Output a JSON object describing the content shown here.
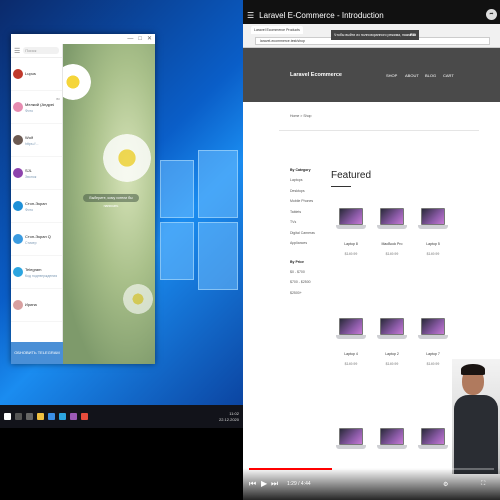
{
  "telegram": {
    "window_controls": [
      "—",
      "□",
      "✕"
    ],
    "search_placeholder": "Поиск",
    "chats": [
      {
        "name": "Lupus",
        "preview": "",
        "time": "",
        "color": "#c0392b"
      },
      {
        "name": "Мелкий (Андрей)",
        "preview": "Фото",
        "time": "вс",
        "color": "#e68bb0"
      },
      {
        "name": "Wolf",
        "preview": "https://...",
        "time": "",
        "color": "#6c5a52"
      },
      {
        "name": "SJL",
        "preview": "Звонок",
        "time": "",
        "color": "#8e44ad"
      },
      {
        "name": "Стоп-Экран",
        "preview": "Фото",
        "time": "",
        "color": "#1e90d8"
      },
      {
        "name": "Стоп-Экран Q",
        "preview": "Стикер",
        "time": "",
        "color": "#3b9be0"
      },
      {
        "name": "Telegram",
        "preview": "Код подтверждения",
        "time": "",
        "color": "#2ca5e0"
      },
      {
        "name": "Ирина",
        "preview": "",
        "time": "",
        "color": "#d8a0a0"
      }
    ],
    "bottom_label": "ОБНОВИТЬ TELEGRAM",
    "empty_hint": "Выберите, кому хотели бы написать"
  },
  "taskbar": {
    "clock_time": "11:02",
    "clock_date": "22.12.2020"
  },
  "youtube": {
    "title": "Laravel E-Commerce - Introduction",
    "share_icon": "share-icon",
    "time_display": "1:29 / 4:44",
    "progress_fraction": 0.34
  },
  "browser": {
    "tab_label": "Laravel Ecommerce Products",
    "url": "laravel-ecommerce.test/shop",
    "notice": "Чтобы выйти из полноэкранного режима, нажмите",
    "notice_key": "F11"
  },
  "site": {
    "brand": "Laravel Ecommerce",
    "nav": [
      "SHOP",
      "ABOUT",
      "BLOG",
      "CART"
    ],
    "breadcrumb": "Home > Shop",
    "category_heading": "By Category",
    "categories": [
      "Laptops",
      "Desktops",
      "Mobile Phones",
      "Tablets",
      "TVs",
      "Digital Cameras",
      "Appliances"
    ],
    "price_heading": "By Price",
    "prices": [
      "$0 - $700",
      "$700 - $2500",
      "$2500+"
    ],
    "featured_title": "Featured",
    "products": [
      {
        "name": "Laptop 8",
        "price": "$149.99"
      },
      {
        "name": "MacBook Pro",
        "price": "$149.99"
      },
      {
        "name": "Laptop 5",
        "price": "$149.99"
      },
      {
        "name": "Laptop 4",
        "price": "$149.99"
      },
      {
        "name": "Laptop 2",
        "price": "$149.99"
      },
      {
        "name": "Laptop 7",
        "price": "$149.99"
      },
      {
        "name": "",
        "price": ""
      },
      {
        "name": "",
        "price": ""
      },
      {
        "name": "",
        "price": ""
      }
    ]
  }
}
